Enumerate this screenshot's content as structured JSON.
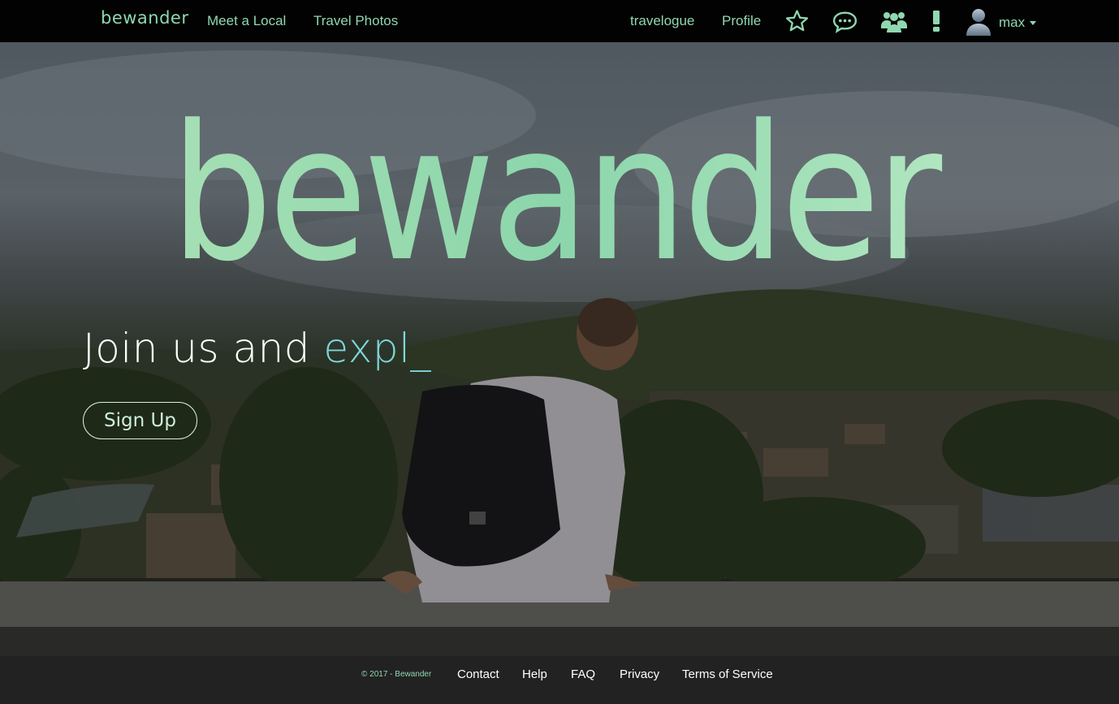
{
  "nav": {
    "brand": "bewander",
    "links": [
      "Meet a Local",
      "Travel Photos"
    ],
    "right_links": [
      "travelogue",
      "Profile"
    ],
    "icons": [
      "star-icon",
      "chat-icon",
      "group-icon",
      "alert-icon"
    ],
    "user": "max",
    "accent_color": "#8fd8b0"
  },
  "hero": {
    "logo_text": "bewander",
    "tagline_prefix": "Join us and ",
    "tagline_typed": "expl_",
    "signup_label": "Sign Up"
  },
  "footer": {
    "copyright": "© 2017 - Bewander",
    "links": [
      "Contact",
      "Help",
      "FAQ",
      "Privacy",
      "Terms of Service"
    ]
  }
}
